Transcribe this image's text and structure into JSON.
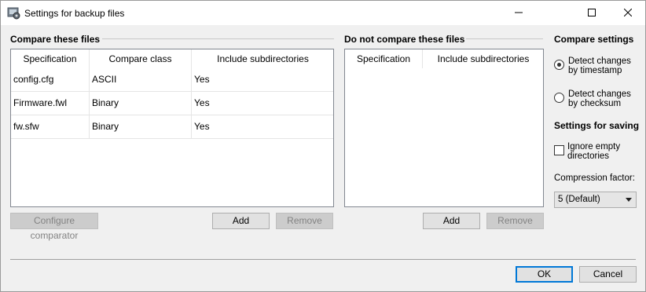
{
  "window": {
    "title": "Settings for backup files"
  },
  "left_group": {
    "title": "Compare these files",
    "columns": [
      "Specification",
      "Compare class",
      "Include subdirectories"
    ],
    "rows": [
      [
        "config.cfg",
        "ASCII",
        "Yes"
      ],
      [
        "Firmware.fwl",
        "Binary",
        "Yes"
      ],
      [
        "fw.sfw",
        "Binary",
        "Yes"
      ]
    ],
    "configure_label": "Configure comparator",
    "add_label": "Add",
    "remove_label": "Remove"
  },
  "middle_group": {
    "title": "Do not compare these files",
    "columns": [
      "Specification",
      "Include subdirectories"
    ],
    "add_label": "Add",
    "remove_label": "Remove"
  },
  "compare_settings": {
    "title": "Compare settings",
    "options": [
      {
        "label": "Detect changes by timestamp",
        "checked": true
      },
      {
        "label": "Detect changes by checksum",
        "checked": false
      }
    ]
  },
  "saving_settings": {
    "title": "Settings for saving",
    "ignore_empty_label": "Ignore empty directories",
    "ignore_empty_checked": false,
    "compression_label": "Compression factor:",
    "compression_value": "5 (Default)"
  },
  "footer": {
    "ok_label": "OK",
    "cancel_label": "Cancel"
  },
  "icons": {
    "app": "settings-app-icon",
    "minimize": "minimize-icon",
    "maximize": "maximize-icon",
    "close": "close-icon",
    "dropdown": "chevron-down-icon"
  }
}
